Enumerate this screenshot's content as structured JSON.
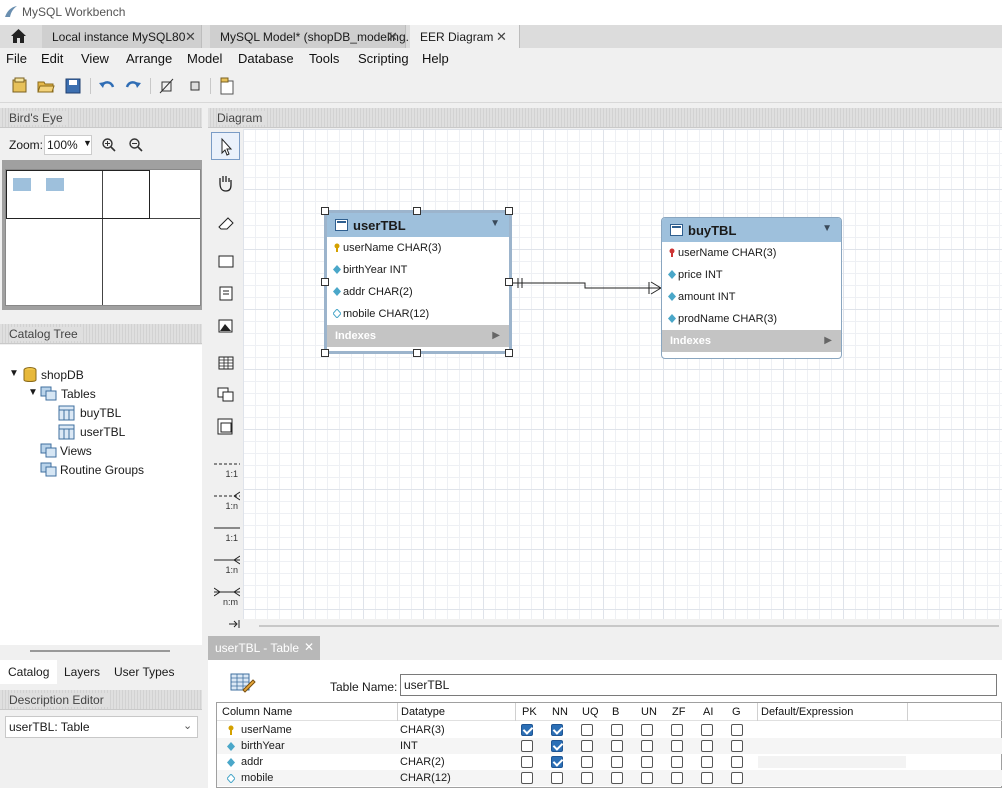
{
  "window": {
    "title": "MySQL Workbench"
  },
  "tabs": [
    {
      "label": "Local instance MySQL80"
    },
    {
      "label": "MySQL Model* (shopDB_modeling."
    },
    {
      "label": "EER Diagram"
    }
  ],
  "menu": [
    "File",
    "Edit",
    "View",
    "Arrange",
    "Model",
    "Database",
    "Tools",
    "Scripting",
    "Help"
  ],
  "birdseye": {
    "header": "Bird's Eye",
    "zoom_label": "Zoom:",
    "zoom_value": "100%"
  },
  "catalog": {
    "header": "Catalog Tree",
    "schema": "shopDB",
    "tables_label": "Tables",
    "tables": [
      "buyTBL",
      "userTBL"
    ],
    "views_label": "Views",
    "routines_label": "Routine Groups"
  },
  "bottom_tabs": [
    "Catalog",
    "Layers",
    "User Types"
  ],
  "description": {
    "header": "Description Editor",
    "selected": "userTBL: Table"
  },
  "diagram": {
    "header": "Diagram",
    "relationships": [
      "1:1",
      "1:n",
      "1:1",
      "1:n",
      "n:m"
    ],
    "tables": [
      {
        "name": "userTBL",
        "columns": [
          {
            "text": "userName CHAR(3)",
            "key": "pk"
          },
          {
            "text": "birthYear INT",
            "key": "nn"
          },
          {
            "text": "addr CHAR(2)",
            "key": "nn"
          },
          {
            "text": "mobile CHAR(12)",
            "key": "col"
          }
        ],
        "indexes_label": "Indexes"
      },
      {
        "name": "buyTBL",
        "columns": [
          {
            "text": "userName CHAR(3)",
            "key": "fk"
          },
          {
            "text": "price INT",
            "key": "nn"
          },
          {
            "text": "amount INT",
            "key": "nn"
          },
          {
            "text": "prodName CHAR(3)",
            "key": "nn"
          }
        ],
        "indexes_label": "Indexes"
      }
    ]
  },
  "editor": {
    "tab_label": "userTBL - Table",
    "table_name_label": "Table Name:",
    "table_name_value": "userTBL",
    "headers": [
      "Column Name",
      "Datatype",
      "PK",
      "NN",
      "UQ",
      "B",
      "UN",
      "ZF",
      "AI",
      "G",
      "Default/Expression"
    ],
    "rows": [
      {
        "name": "userName",
        "type": "CHAR(3)",
        "flags": [
          true,
          true,
          false,
          false,
          false,
          false,
          false,
          false
        ],
        "icon": "pk"
      },
      {
        "name": "birthYear",
        "type": "INT",
        "flags": [
          false,
          true,
          false,
          false,
          false,
          false,
          false,
          false
        ],
        "icon": "nn"
      },
      {
        "name": "addr",
        "type": "CHAR(2)",
        "flags": [
          false,
          true,
          false,
          false,
          false,
          false,
          false,
          false
        ],
        "icon": "nn"
      },
      {
        "name": "mobile",
        "type": "CHAR(12)",
        "flags": [
          false,
          false,
          false,
          false,
          false,
          false,
          false,
          false
        ],
        "icon": "col"
      }
    ]
  },
  "colors": {
    "table_header": "#9ec0dc",
    "checkbox_on": "#2b6fb6",
    "pk_key": "#d4a100",
    "fk_key": "#cc3333",
    "nn_diamond": "#4aa7c9"
  }
}
